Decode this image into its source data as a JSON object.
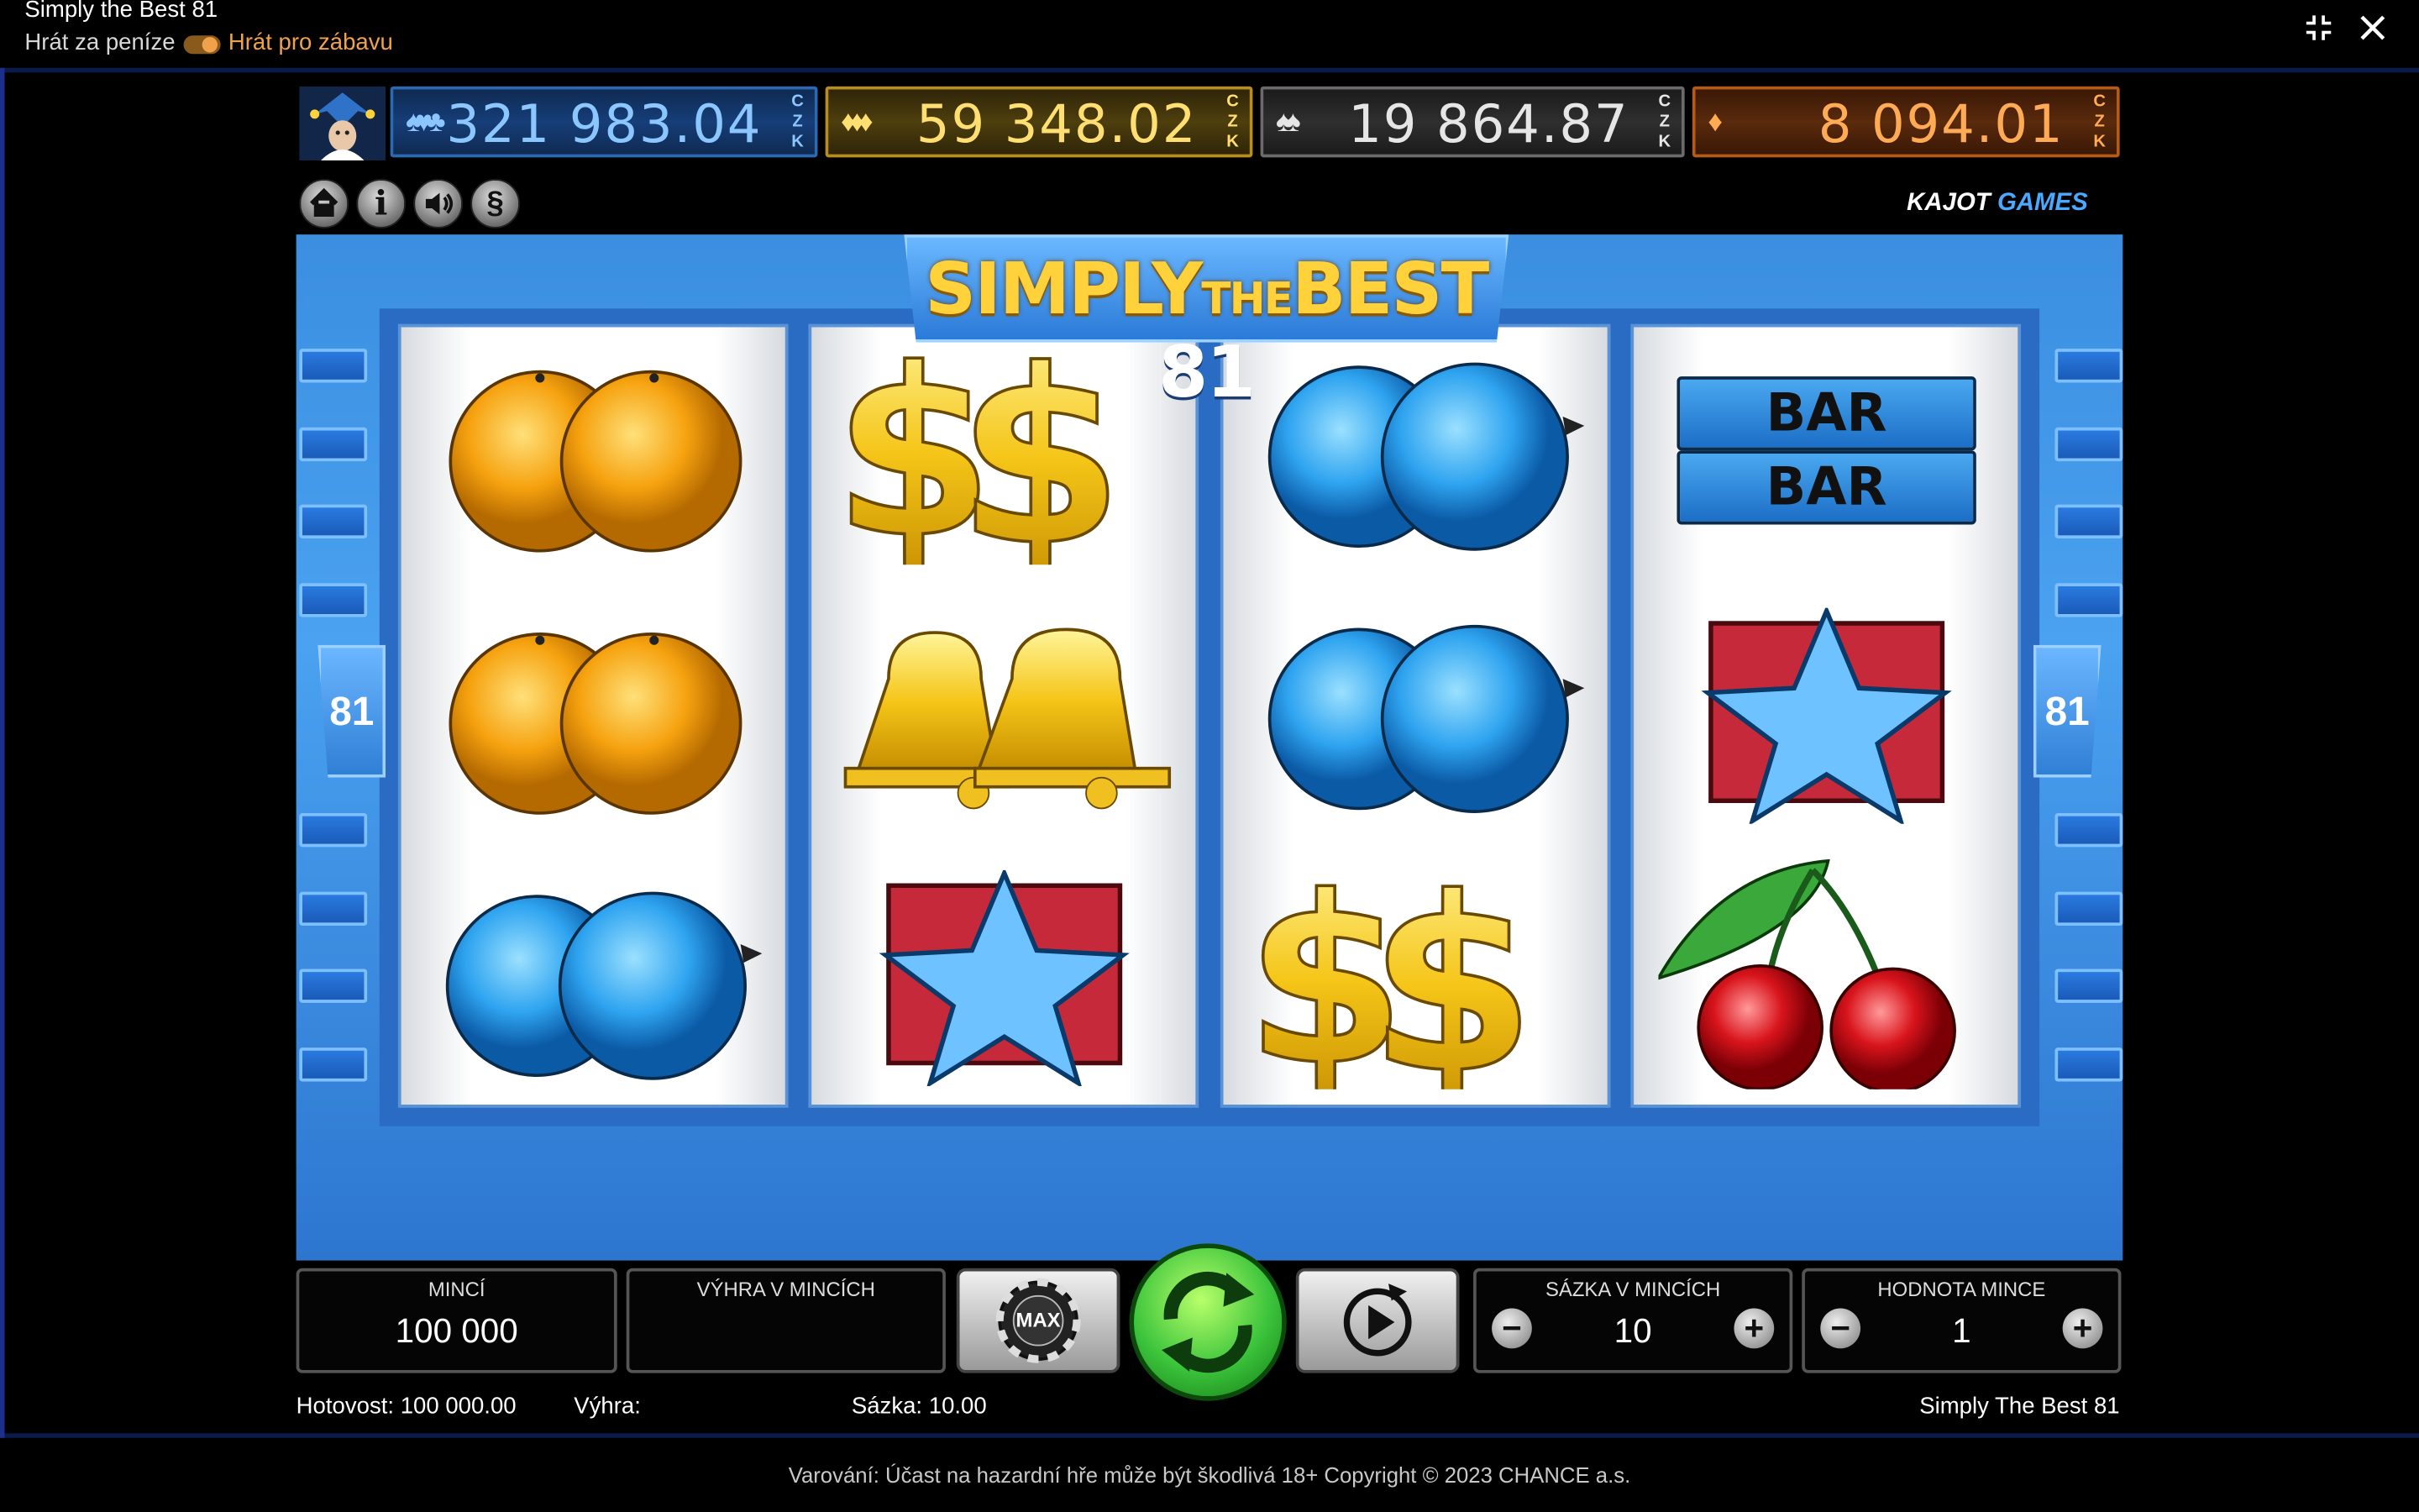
{
  "window": {
    "title": "Simply the Best 81",
    "mode_real": "Hrát za peníze",
    "mode_fun": "Hrát pro zábavu",
    "mode_fun_active": true
  },
  "jackpots": [
    {
      "suit": "hearts-clubs",
      "amount": "321 983.04",
      "currency": [
        "C",
        "Z",
        "K"
      ],
      "color": "#8cc6ff"
    },
    {
      "suit": "diamonds",
      "amount": "59 348.02",
      "currency": [
        "C",
        "Z",
        "K"
      ],
      "color": "#ffdf72"
    },
    {
      "suit": "spades",
      "amount": "19 864.87",
      "currency": [
        "C",
        "Z",
        "K"
      ],
      "color": "#e6e6e6"
    },
    {
      "suit": "single",
      "amount": "8 094.01",
      "currency": [
        "C",
        "Z",
        "K"
      ],
      "color": "#ffaa55"
    }
  ],
  "toolbar": {
    "buttons": [
      {
        "name": "home-icon"
      },
      {
        "name": "info-icon"
      },
      {
        "name": "sound-icon"
      },
      {
        "name": "paragraph-icon",
        "glyph": "§"
      }
    ],
    "brand_a": "KAJOT",
    "brand_b": "GAMES"
  },
  "game": {
    "title_a": "SIMPLY",
    "title_b": "THE",
    "title_c": "BEST",
    "title_num": "81",
    "lines_left": "81",
    "lines_right": "81",
    "reels": [
      [
        "orange",
        "orange",
        "plum"
      ],
      [
        "dollar",
        "bell",
        "star"
      ],
      [
        "plum",
        "plum",
        "dollar"
      ],
      [
        "bar",
        "star",
        "cherry"
      ]
    ],
    "bar_text": "BAR"
  },
  "controls": {
    "coins_label": "MINCÍ",
    "coins_value": "100 000",
    "win_label": "VÝHRA V MINCÍCH",
    "win_value": "",
    "max_label": "MAX",
    "bet_label": "SÁZKA V MINCÍCH",
    "bet_value": "10",
    "coin_value_label": "HODNOTA MINCE",
    "coin_value": "1"
  },
  "status": {
    "cash_label": "Hotovost:",
    "cash_value": "100 000.00",
    "win_label": "Výhra:",
    "win_value": "",
    "bet_label": "Sázka:",
    "bet_value": "10.00",
    "game_name": "Simply The Best 81"
  },
  "footer": "Varování: Účast na hazardní hře může být škodlivá 18+ Copyright © 2023 CHANCE a.s."
}
